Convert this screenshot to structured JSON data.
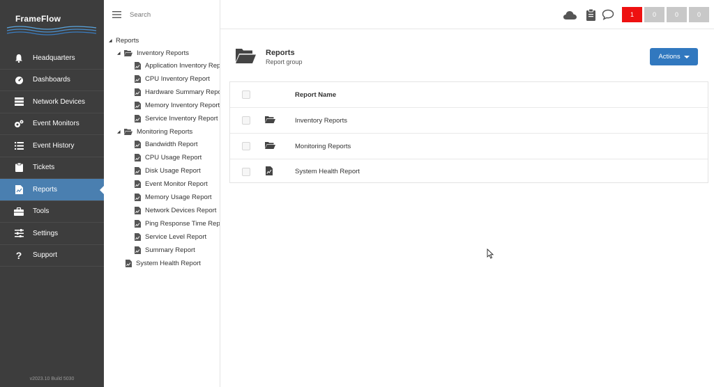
{
  "app": {
    "logo": "FrameFlow",
    "version": "v2023.10 Build 5030"
  },
  "nav": {
    "items": [
      {
        "label": "Headquarters",
        "icon": "bell-icon"
      },
      {
        "label": "Dashboards",
        "icon": "gauge-icon"
      },
      {
        "label": "Network Devices",
        "icon": "server-icon"
      },
      {
        "label": "Event Monitors",
        "icon": "gears-icon"
      },
      {
        "label": "Event History",
        "icon": "list-icon"
      },
      {
        "label": "Tickets",
        "icon": "clipboard-icon"
      },
      {
        "label": "Reports",
        "icon": "report-icon",
        "active": true
      },
      {
        "label": "Tools",
        "icon": "toolbox-icon"
      },
      {
        "label": "Settings",
        "icon": "sliders-icon"
      },
      {
        "label": "Support",
        "icon": "question-icon"
      }
    ]
  },
  "tree": {
    "search_placeholder": "Search",
    "nodes": [
      {
        "label": "Reports",
        "type": "root"
      },
      {
        "label": "Inventory Reports",
        "type": "folder"
      },
      {
        "label": "Application Inventory Report",
        "type": "doc"
      },
      {
        "label": "CPU Inventory Report",
        "type": "doc"
      },
      {
        "label": "Hardware Summary Report",
        "type": "doc"
      },
      {
        "label": "Memory Inventory Report",
        "type": "doc"
      },
      {
        "label": "Service Inventory Report",
        "type": "doc"
      },
      {
        "label": "Monitoring Reports",
        "type": "folder"
      },
      {
        "label": "Bandwidth Report",
        "type": "doc"
      },
      {
        "label": "CPU Usage Report",
        "type": "doc"
      },
      {
        "label": "Disk Usage Report",
        "type": "doc"
      },
      {
        "label": "Event Monitor Report",
        "type": "doc"
      },
      {
        "label": "Memory Usage Report",
        "type": "doc"
      },
      {
        "label": "Network Devices Report",
        "type": "doc"
      },
      {
        "label": "Ping Response Time Report",
        "type": "doc"
      },
      {
        "label": "Service Level Report",
        "type": "doc"
      },
      {
        "label": "Summary Report",
        "type": "doc"
      },
      {
        "label": "System Health Report",
        "type": "doc"
      }
    ]
  },
  "topbar": {
    "icons": [
      "cloud-icon",
      "clipboard-icon",
      "chat-icon"
    ],
    "badges": [
      {
        "value": "1",
        "color": "#ee1111"
      },
      {
        "value": "0",
        "color": "#c8c8c8"
      },
      {
        "value": "0",
        "color": "#c8c8c8"
      },
      {
        "value": "0",
        "color": "#c8c8c8"
      }
    ]
  },
  "main": {
    "title": "Reports",
    "subtitle": "Report group",
    "actions_label": "Actions",
    "table": {
      "header": "Report Name",
      "rows": [
        {
          "name": "Inventory Reports",
          "icon": "folder-open-icon"
        },
        {
          "name": "Monitoring Reports",
          "icon": "folder-open-icon"
        },
        {
          "name": "System Health Report",
          "icon": "report-doc-icon"
        }
      ]
    }
  },
  "colors": {
    "nav_bg": "#3d3d3d",
    "nav_active": "#4a7fb0",
    "accent": "#3178bf",
    "alert": "#ee1111"
  }
}
